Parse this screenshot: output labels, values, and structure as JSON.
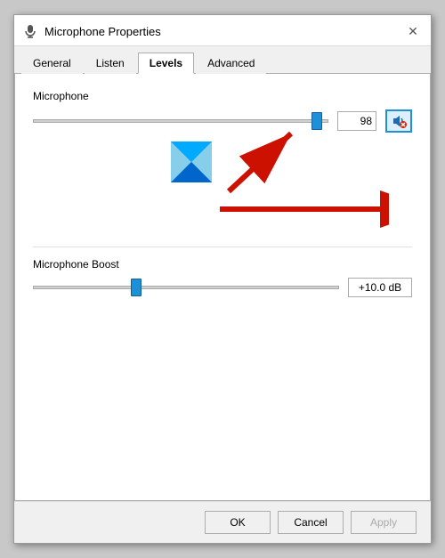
{
  "window": {
    "title": "Microphone Properties",
    "icon": "microphone-icon"
  },
  "tabs": [
    {
      "label": "General",
      "active": false
    },
    {
      "label": "Listen",
      "active": false
    },
    {
      "label": "Levels",
      "active": true
    },
    {
      "label": "Advanced",
      "active": false
    }
  ],
  "levels": {
    "microphone": {
      "label": "Microphone",
      "value": 98,
      "min": 0,
      "max": 100
    },
    "microphone_boost": {
      "label": "Microphone Boost",
      "value": "+10.0 dB",
      "slider_pct": 33
    }
  },
  "footer": {
    "ok_label": "OK",
    "cancel_label": "Cancel",
    "apply_label": "Apply"
  }
}
